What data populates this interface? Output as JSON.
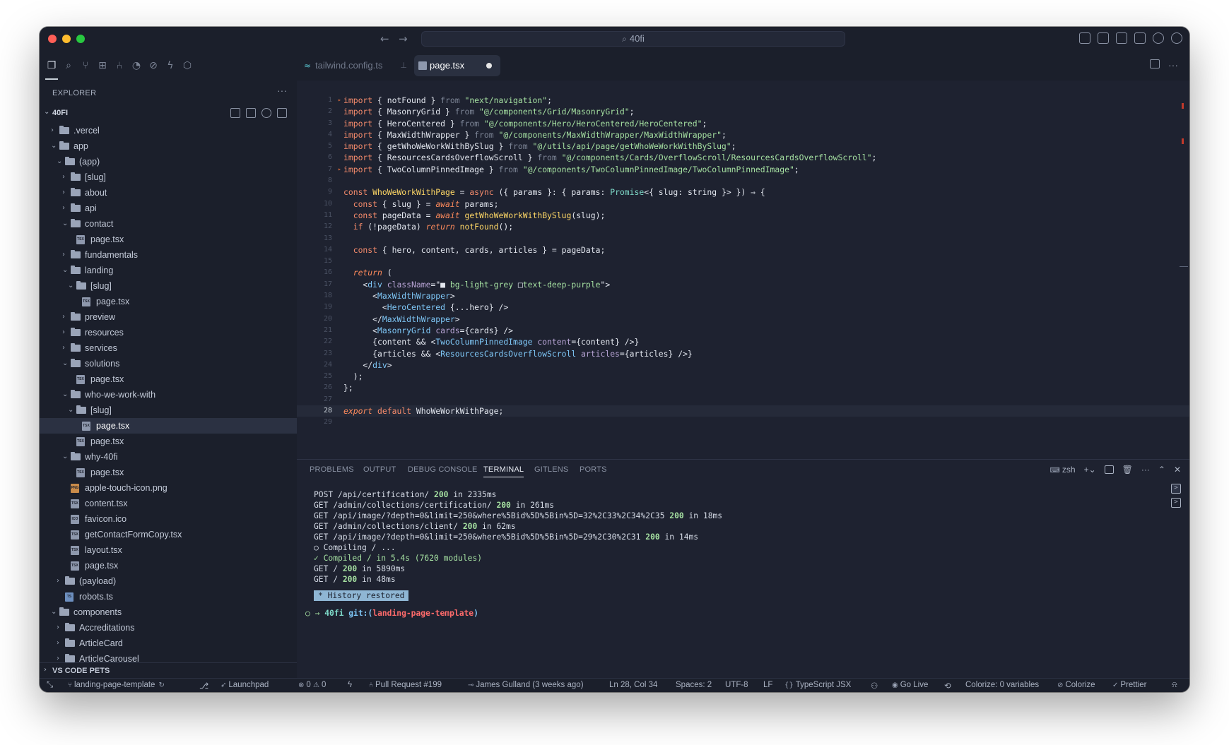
{
  "titlebar": {
    "search": "40fi"
  },
  "sidebar": {
    "title": "EXPLORER",
    "project": "40FI",
    "tree": [
      {
        "label": ".vercel",
        "type": "folder",
        "depth": 1,
        "open": false
      },
      {
        "label": "app",
        "type": "folder",
        "depth": 1,
        "open": true
      },
      {
        "label": "(app)",
        "type": "folder",
        "depth": 2,
        "open": true
      },
      {
        "label": "[slug]",
        "type": "folder",
        "depth": 3,
        "open": false
      },
      {
        "label": "about",
        "type": "folder",
        "depth": 3,
        "open": false
      },
      {
        "label": "api",
        "type": "folder",
        "depth": 3,
        "open": false
      },
      {
        "label": "contact",
        "type": "folder",
        "depth": 3,
        "open": true
      },
      {
        "label": "page.tsx",
        "type": "file",
        "icon": "TSX",
        "depth": 4
      },
      {
        "label": "fundamentals",
        "type": "folder",
        "depth": 3,
        "open": false
      },
      {
        "label": "landing",
        "type": "folder",
        "depth": 3,
        "open": true
      },
      {
        "label": "[slug]",
        "type": "folder",
        "depth": 4,
        "open": true
      },
      {
        "label": "page.tsx",
        "type": "file",
        "icon": "TSX",
        "depth": 5
      },
      {
        "label": "preview",
        "type": "folder",
        "depth": 3,
        "open": false
      },
      {
        "label": "resources",
        "type": "folder",
        "depth": 3,
        "open": false
      },
      {
        "label": "services",
        "type": "folder",
        "depth": 3,
        "open": false
      },
      {
        "label": "solutions",
        "type": "folder",
        "depth": 3,
        "open": true
      },
      {
        "label": "page.tsx",
        "type": "file",
        "icon": "TSX",
        "depth": 4
      },
      {
        "label": "who-we-work-with",
        "type": "folder",
        "depth": 3,
        "open": true
      },
      {
        "label": "[slug]",
        "type": "folder",
        "depth": 4,
        "open": true
      },
      {
        "label": "page.tsx",
        "type": "file",
        "icon": "TSX",
        "depth": 5,
        "selected": true
      },
      {
        "label": "page.tsx",
        "type": "file",
        "icon": "TSX",
        "depth": 4
      },
      {
        "label": "why-40fi",
        "type": "folder",
        "depth": 3,
        "open": true
      },
      {
        "label": "page.tsx",
        "type": "file",
        "icon": "TSX",
        "depth": 4
      },
      {
        "label": "apple-touch-icon.png",
        "type": "file",
        "icon": "PNG",
        "depth": 3
      },
      {
        "label": "content.tsx",
        "type": "file",
        "icon": "TSX",
        "depth": 3
      },
      {
        "label": "favicon.ico",
        "type": "file",
        "icon": "ICO",
        "depth": 3
      },
      {
        "label": "getContactFormCopy.tsx",
        "type": "file",
        "icon": "TSX",
        "depth": 3
      },
      {
        "label": "layout.tsx",
        "type": "file",
        "icon": "TSX",
        "depth": 3
      },
      {
        "label": "page.tsx",
        "type": "file",
        "icon": "TSX",
        "depth": 3
      },
      {
        "label": "(payload)",
        "type": "folder",
        "depth": 2,
        "open": false
      },
      {
        "label": "robots.ts",
        "type": "file",
        "icon": "TS",
        "depth": 2
      },
      {
        "label": "components",
        "type": "folder",
        "depth": 1,
        "open": true
      },
      {
        "label": "Accreditations",
        "type": "folder",
        "depth": 2,
        "open": false
      },
      {
        "label": "ArticleCard",
        "type": "folder",
        "depth": 2,
        "open": false
      },
      {
        "label": "ArticleCarousel",
        "type": "folder",
        "depth": 2,
        "open": false
      }
    ],
    "pets": "VS CODE PETS"
  },
  "tabs": [
    {
      "label": "tailwind.config.ts",
      "active": false
    },
    {
      "label": "page.tsx",
      "active": true,
      "dirty": true
    }
  ],
  "code": {
    "current_line": 28,
    "lines": [
      [
        [
          "kw",
          "import"
        ],
        [
          "p",
          " { "
        ],
        [
          "v",
          "notFound"
        ],
        [
          "p",
          " } "
        ],
        [
          "cm",
          "from"
        ],
        [
          "p",
          " "
        ],
        [
          "str",
          "\"next/navigation\""
        ],
        [
          "p",
          ";"
        ]
      ],
      [
        [
          "kw",
          "import"
        ],
        [
          "p",
          " { "
        ],
        [
          "v",
          "MasonryGrid"
        ],
        [
          "p",
          " } "
        ],
        [
          "cm",
          "from"
        ],
        [
          "p",
          " "
        ],
        [
          "str",
          "\"@/components/Grid/MasonryGrid\""
        ],
        [
          "p",
          ";"
        ]
      ],
      [
        [
          "kw",
          "import"
        ],
        [
          "p",
          " { "
        ],
        [
          "v",
          "HeroCentered"
        ],
        [
          "p",
          " } "
        ],
        [
          "cm",
          "from"
        ],
        [
          "p",
          " "
        ],
        [
          "str",
          "\"@/components/Hero/HeroCentered/HeroCentered\""
        ],
        [
          "p",
          ";"
        ]
      ],
      [
        [
          "kw",
          "import"
        ],
        [
          "p",
          " { "
        ],
        [
          "v",
          "MaxWidthWrapper"
        ],
        [
          "p",
          " } "
        ],
        [
          "cm",
          "from"
        ],
        [
          "p",
          " "
        ],
        [
          "str",
          "\"@/components/MaxWidthWrapper/MaxWidthWrapper\""
        ],
        [
          "p",
          ";"
        ]
      ],
      [
        [
          "kw",
          "import"
        ],
        [
          "p",
          " { "
        ],
        [
          "v",
          "getWhoWeWorkWithBySlug"
        ],
        [
          "p",
          " } "
        ],
        [
          "cm",
          "from"
        ],
        [
          "p",
          " "
        ],
        [
          "str",
          "\"@/utils/api/page/getWhoWeWorkWithBySlug\""
        ],
        [
          "p",
          ";"
        ]
      ],
      [
        [
          "kw",
          "import"
        ],
        [
          "p",
          " { "
        ],
        [
          "v",
          "ResourcesCardsOverflowScroll"
        ],
        [
          "p",
          " } "
        ],
        [
          "cm",
          "from"
        ],
        [
          "p",
          " "
        ],
        [
          "str",
          "\"@/components/Cards/OverflowScroll/ResourcesCardsOverflowScroll\""
        ],
        [
          "p",
          ";"
        ]
      ],
      [
        [
          "kw",
          "import"
        ],
        [
          "p",
          " { "
        ],
        [
          "v",
          "TwoColumnPinnedImage"
        ],
        [
          "p",
          " } "
        ],
        [
          "cm",
          "from"
        ],
        [
          "p",
          " "
        ],
        [
          "str",
          "\"@/components/TwoColumnPinnedImage/TwoColumnPinnedImage\""
        ],
        [
          "p",
          ";"
        ]
      ],
      [],
      [
        [
          "kw",
          "const"
        ],
        [
          "p",
          " "
        ],
        [
          "fn",
          "WhoWeWorkWithPage"
        ],
        [
          "p",
          " = "
        ],
        [
          "kw",
          "async"
        ],
        [
          "p",
          " ({ "
        ],
        [
          "v",
          "params"
        ],
        [
          "p",
          " }: { "
        ],
        [
          "v",
          "params"
        ],
        [
          "p",
          ": "
        ],
        [
          "ty",
          "Promise"
        ],
        [
          "p",
          "<{ "
        ],
        [
          "v",
          "slug"
        ],
        [
          "p",
          ": "
        ],
        [
          "v",
          "string"
        ],
        [
          "p",
          " }> }) ⇒ {"
        ]
      ],
      [
        [
          "p",
          "  "
        ],
        [
          "kw",
          "const"
        ],
        [
          "p",
          " { "
        ],
        [
          "v",
          "slug"
        ],
        [
          "p",
          " } = "
        ],
        [
          "kw2",
          "await"
        ],
        [
          "p",
          " "
        ],
        [
          "v",
          "params"
        ],
        [
          "p",
          ";"
        ]
      ],
      [
        [
          "p",
          "  "
        ],
        [
          "kw",
          "const"
        ],
        [
          "p",
          " "
        ],
        [
          "v",
          "pageData"
        ],
        [
          "p",
          " = "
        ],
        [
          "kw2",
          "await"
        ],
        [
          "p",
          " "
        ],
        [
          "fn",
          "getWhoWeWorkWithBySlug"
        ],
        [
          "p",
          "("
        ],
        [
          "v",
          "slug"
        ],
        [
          "p",
          ");"
        ]
      ],
      [
        [
          "p",
          "  "
        ],
        [
          "kw",
          "if"
        ],
        [
          "p",
          " (!"
        ],
        [
          "v",
          "pageData"
        ],
        [
          "p",
          ") "
        ],
        [
          "kw2",
          "return"
        ],
        [
          "p",
          " "
        ],
        [
          "fn",
          "notFound"
        ],
        [
          "p",
          "();"
        ]
      ],
      [],
      [
        [
          "p",
          "  "
        ],
        [
          "kw",
          "const"
        ],
        [
          "p",
          " { "
        ],
        [
          "v",
          "hero"
        ],
        [
          "p",
          ", "
        ],
        [
          "v",
          "content"
        ],
        [
          "p",
          ", "
        ],
        [
          "v",
          "cards"
        ],
        [
          "p",
          ", "
        ],
        [
          "v",
          "articles"
        ],
        [
          "p",
          " } = "
        ],
        [
          "v",
          "pageData"
        ],
        [
          "p",
          ";"
        ]
      ],
      [],
      [
        [
          "p",
          "  "
        ],
        [
          "kw2",
          "return"
        ],
        [
          "p",
          " ("
        ]
      ],
      [
        [
          "p",
          "    <"
        ],
        [
          "tg",
          "div"
        ],
        [
          "p",
          " "
        ],
        [
          "at",
          "className"
        ],
        [
          "p",
          "=\""
        ],
        [
          "v",
          "■ "
        ],
        [
          "str",
          "bg-light-grey"
        ],
        [
          "p",
          " "
        ],
        [
          "v",
          "□"
        ],
        [
          "str",
          "text-deep-purple"
        ],
        [
          "p",
          "\">"
        ]
      ],
      [
        [
          "p",
          "      <"
        ],
        [
          "tg",
          "MaxWidthWrapper"
        ],
        [
          "p",
          ">"
        ]
      ],
      [
        [
          "p",
          "        <"
        ],
        [
          "tg",
          "HeroCentered"
        ],
        [
          "p",
          " {"
        ],
        [
          "v",
          "..."
        ],
        [
          "v",
          "hero"
        ],
        [
          "p",
          "} />"
        ]
      ],
      [
        [
          "p",
          "      </"
        ],
        [
          "tg",
          "MaxWidthWrapper"
        ],
        [
          "p",
          ">"
        ]
      ],
      [
        [
          "p",
          "      <"
        ],
        [
          "tg",
          "MasonryGrid"
        ],
        [
          "p",
          " "
        ],
        [
          "at",
          "cards"
        ],
        [
          "p",
          "={"
        ],
        [
          "v",
          "cards"
        ],
        [
          "p",
          "} />"
        ]
      ],
      [
        [
          "p",
          "      {"
        ],
        [
          "v",
          "content"
        ],
        [
          "p",
          " && <"
        ],
        [
          "tg",
          "TwoColumnPinnedImage"
        ],
        [
          "p",
          " "
        ],
        [
          "at",
          "content"
        ],
        [
          "p",
          "={"
        ],
        [
          "v",
          "content"
        ],
        [
          "p",
          "} />}"
        ]
      ],
      [
        [
          "p",
          "      {"
        ],
        [
          "v",
          "articles"
        ],
        [
          "p",
          " && <"
        ],
        [
          "tg",
          "ResourcesCardsOverflowScroll"
        ],
        [
          "p",
          " "
        ],
        [
          "at",
          "articles"
        ],
        [
          "p",
          "={"
        ],
        [
          "v",
          "articles"
        ],
        [
          "p",
          "} />}"
        ]
      ],
      [
        [
          "p",
          "    </"
        ],
        [
          "tg",
          "div"
        ],
        [
          "p",
          ">"
        ]
      ],
      [
        [
          "p",
          "  );"
        ]
      ],
      [
        [
          "p",
          "};"
        ]
      ],
      [],
      [
        [
          "kw2",
          "export"
        ],
        [
          "p",
          " "
        ],
        [
          "kw",
          "default"
        ],
        [
          "p",
          " "
        ],
        [
          "v",
          "WhoWeWorkWithPage"
        ],
        [
          "p",
          ";"
        ]
      ],
      []
    ]
  },
  "panel": {
    "tabs": [
      "PROBLEMS",
      "OUTPUT",
      "DEBUG CONSOLE",
      "TERMINAL",
      "GITLENS",
      "PORTS"
    ],
    "active_tab": "TERMINAL",
    "shell": "zsh",
    "terminal": [
      [
        "POST /api/certification/ ",
        "200",
        " in 2335ms"
      ],
      [
        "GET /admin/collections/certification/ ",
        "200",
        " in 261ms"
      ],
      [
        "GET /api/image/?depth=0&limit=250&where%5Bid%5D%5Bin%5D=32%2C33%2C34%2C35 ",
        "200",
        " in 18ms"
      ],
      [
        "GET /admin/collections/client/ ",
        "200",
        " in 62ms"
      ],
      [
        "GET /api/image/?depth=0&limit=250&where%5Bid%5D%5Bin%5D=29%2C30%2C31 ",
        "200",
        " in 14ms"
      ],
      [
        "○ Compiling / ...",
        "",
        ""
      ],
      [
        "✓ Compiled / in 5.4s (7620 modules)",
        "",
        ""
      ],
      [
        "GET / ",
        "200",
        " in 5890ms"
      ],
      [
        "GET / ",
        "200",
        " in 48ms"
      ]
    ],
    "history": "* History restored",
    "prompt": {
      "arrow": "○ →",
      "dir": "40fi",
      "git": "git:(",
      "branch": "landing-page-template",
      "close": ")"
    }
  },
  "status": {
    "branch": "landing-page-template",
    "launchpad": "Launchpad",
    "problems": "0",
    "warnings": "0",
    "pr": "Pull Request #199",
    "blame": "James Gulland (3 weeks ago)",
    "position": "Ln 28, Col 34",
    "spaces": "Spaces: 2",
    "encoding": "UTF-8",
    "eol": "LF",
    "language": "TypeScript JSX",
    "golive": "Go Live",
    "colorize_vars": "Colorize: 0 variables",
    "colorize": "Colorize",
    "prettier": "Prettier"
  }
}
